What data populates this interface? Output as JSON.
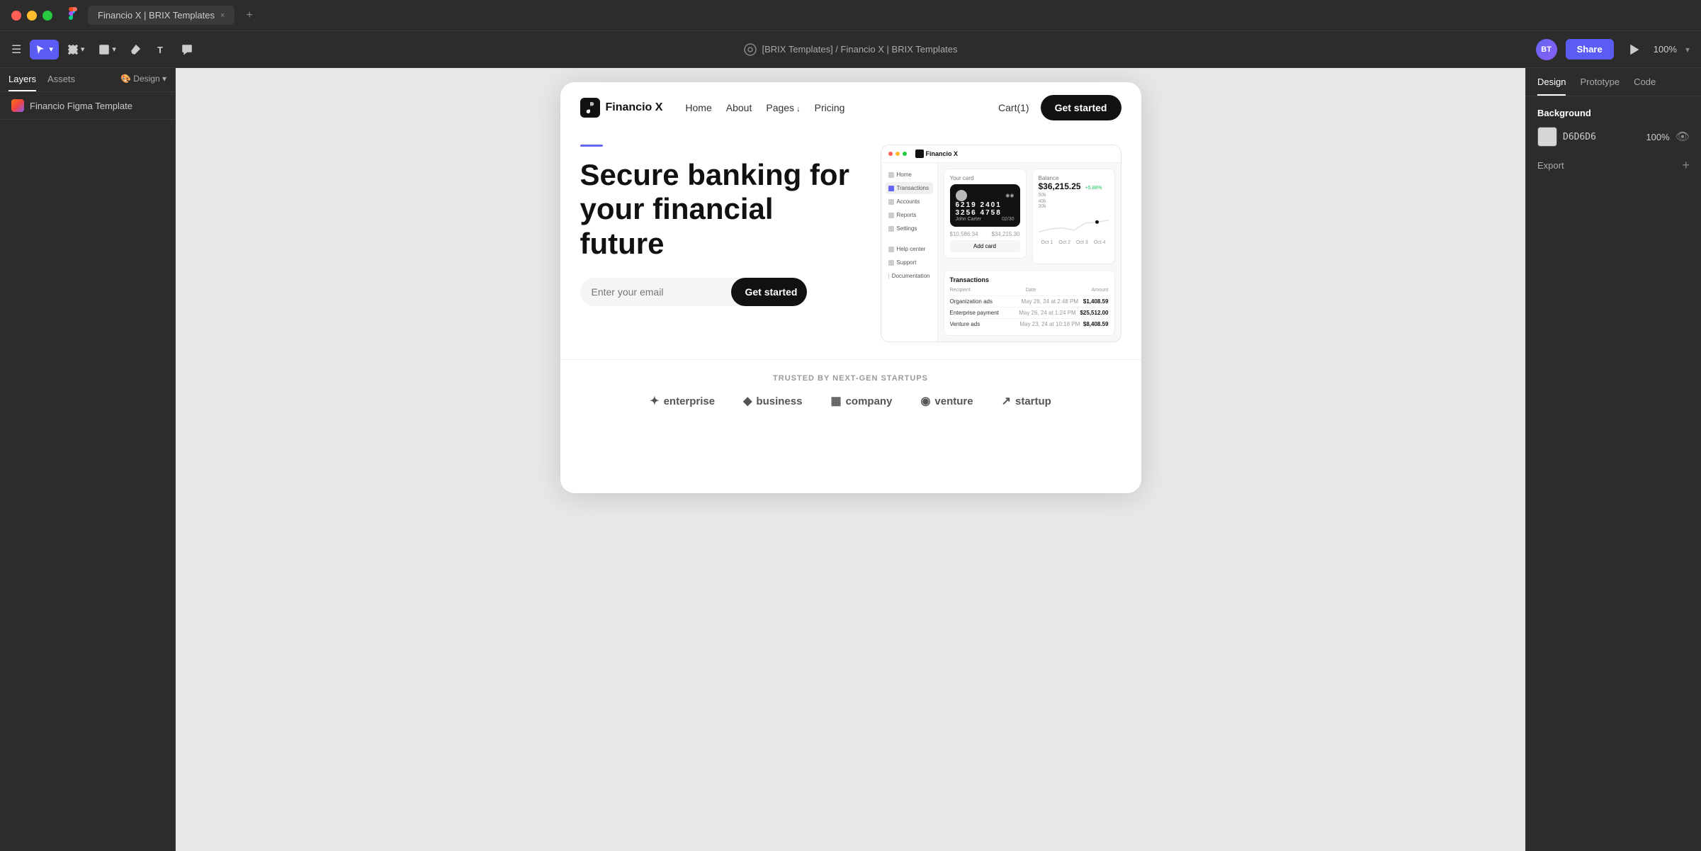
{
  "titlebar": {
    "tab_title": "Financio X | BRIX Templates",
    "tab_close": "×",
    "tab_add": "+"
  },
  "toolbar": {
    "hamburger": "☰",
    "breadcrumb": "[BRIX Templates] / Financio X | BRIX Templates",
    "share_label": "Share",
    "zoom": "100%"
  },
  "left_panel": {
    "tabs": [
      "Layers",
      "Assets"
    ],
    "design_tab": "🎨 Design ▾",
    "layer_item": "Financio Figma Template"
  },
  "right_panel": {
    "tabs": [
      "Design",
      "Prototype",
      "Code"
    ],
    "background_section": "Background",
    "color_hex": "D6D6D6",
    "color_opacity": "100%",
    "export_label": "Export",
    "export_add": "+"
  },
  "nav": {
    "logo": "Financio X",
    "links": [
      "Home",
      "About",
      "Pages",
      "Pricing",
      "Cart(1)"
    ],
    "cta": "Get started"
  },
  "hero": {
    "title": "Secure banking for your financial future",
    "input_placeholder": "Enter your email",
    "cta": "Get started"
  },
  "app_preview": {
    "logo": "Financio X",
    "sidebar_items": [
      "Home",
      "Transactions",
      "Accounts",
      "Reports",
      "Settings",
      "Help center",
      "Support",
      "Documentation"
    ],
    "card_number": "6219  2401  3256  4758",
    "card_name": "John Carter",
    "card_expiry": "02/30",
    "card_add": "Add card",
    "balance_label": "Balance",
    "balance_amount": "$36,215.25",
    "balance_growth": "+5.88%",
    "transaction_header": "Transactions",
    "tx_cols": [
      "Recipient",
      "Date",
      "Amount"
    ],
    "transactions": [
      {
        "name": "Organization ads",
        "date": "May 26, 24 at 2:48 PM",
        "amount": "$1,408.59"
      },
      {
        "name": "Enterprise payment",
        "date": "May 26, 24 at 1:24 PM",
        "amount": "$25,512.00"
      },
      {
        "name": "Venture ads",
        "date": "May 23, 24 at 10:18 PM",
        "amount": "$8,408.59"
      }
    ],
    "add_card_label": "Add card",
    "bottom_amounts": [
      "$10,586.34",
      "$34,215.30"
    ]
  },
  "trusted": {
    "label": "TRUSTED BY NEXT-GEN STARTUPS",
    "brands": [
      {
        "icon": "✦",
        "name": "enterprise"
      },
      {
        "icon": "◆",
        "name": "business"
      },
      {
        "icon": "▦",
        "name": "company"
      },
      {
        "icon": "◉",
        "name": "venture"
      },
      {
        "icon": "↗",
        "name": "startup"
      }
    ]
  }
}
